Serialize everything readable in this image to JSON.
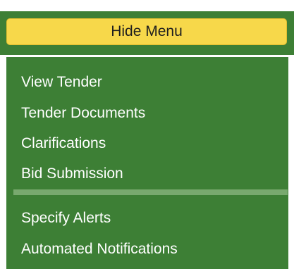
{
  "menu": {
    "hide_label": "Hide Menu",
    "items_group1": [
      "View Tender",
      "Tender Documents",
      "Clarifications",
      "Bid Submission"
    ],
    "items_group2": [
      "Specify Alerts",
      "Automated Notifications"
    ]
  },
  "colors": {
    "menu_green": "#3d7f35",
    "button_yellow": "#f7d84a",
    "separator": "#78a96e",
    "text_light": "#ffffff"
  }
}
